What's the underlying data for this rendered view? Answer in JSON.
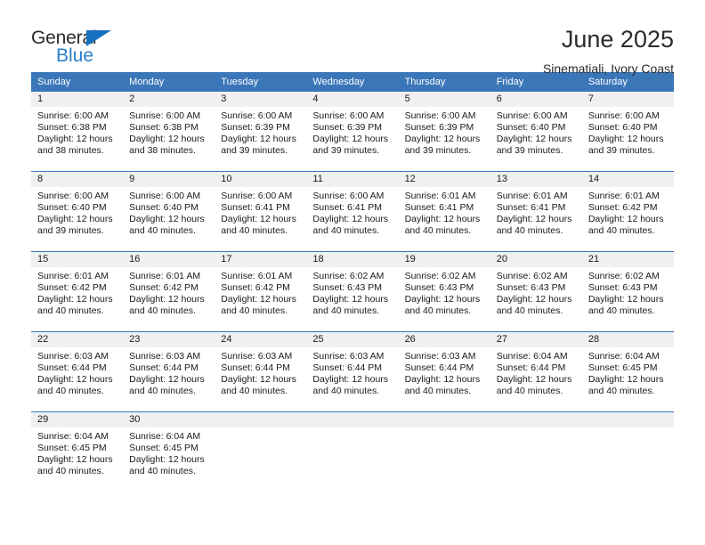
{
  "brand": {
    "name_top": "General",
    "name_bottom": "Blue",
    "triangle_color": "#1670c0",
    "blue_color": "#2a7fc9"
  },
  "header": {
    "title": "June 2025",
    "subtitle": "Sinematiali, Ivory Coast"
  },
  "theme": {
    "header_bg": "#3a76b8",
    "daynum_bg": "#f0f0f0",
    "text": "#1a1a1a"
  },
  "calendar": {
    "weekday_headers": [
      "Sunday",
      "Monday",
      "Tuesday",
      "Wednesday",
      "Thursday",
      "Friday",
      "Saturday"
    ],
    "labels": {
      "sunrise": "Sunrise:",
      "sunset": "Sunset:",
      "daylight": "Daylight:"
    },
    "weeks": [
      [
        {
          "day": "1",
          "sunrise": "Sunrise: 6:00 AM",
          "sunset": "Sunset: 6:38 PM",
          "daylight1": "Daylight: 12 hours",
          "daylight2": "and 38 minutes."
        },
        {
          "day": "2",
          "sunrise": "Sunrise: 6:00 AM",
          "sunset": "Sunset: 6:38 PM",
          "daylight1": "Daylight: 12 hours",
          "daylight2": "and 38 minutes."
        },
        {
          "day": "3",
          "sunrise": "Sunrise: 6:00 AM",
          "sunset": "Sunset: 6:39 PM",
          "daylight1": "Daylight: 12 hours",
          "daylight2": "and 39 minutes."
        },
        {
          "day": "4",
          "sunrise": "Sunrise: 6:00 AM",
          "sunset": "Sunset: 6:39 PM",
          "daylight1": "Daylight: 12 hours",
          "daylight2": "and 39 minutes."
        },
        {
          "day": "5",
          "sunrise": "Sunrise: 6:00 AM",
          "sunset": "Sunset: 6:39 PM",
          "daylight1": "Daylight: 12 hours",
          "daylight2": "and 39 minutes."
        },
        {
          "day": "6",
          "sunrise": "Sunrise: 6:00 AM",
          "sunset": "Sunset: 6:40 PM",
          "daylight1": "Daylight: 12 hours",
          "daylight2": "and 39 minutes."
        },
        {
          "day": "7",
          "sunrise": "Sunrise: 6:00 AM",
          "sunset": "Sunset: 6:40 PM",
          "daylight1": "Daylight: 12 hours",
          "daylight2": "and 39 minutes."
        }
      ],
      [
        {
          "day": "8",
          "sunrise": "Sunrise: 6:00 AM",
          "sunset": "Sunset: 6:40 PM",
          "daylight1": "Daylight: 12 hours",
          "daylight2": "and 39 minutes."
        },
        {
          "day": "9",
          "sunrise": "Sunrise: 6:00 AM",
          "sunset": "Sunset: 6:40 PM",
          "daylight1": "Daylight: 12 hours",
          "daylight2": "and 40 minutes."
        },
        {
          "day": "10",
          "sunrise": "Sunrise: 6:00 AM",
          "sunset": "Sunset: 6:41 PM",
          "daylight1": "Daylight: 12 hours",
          "daylight2": "and 40 minutes."
        },
        {
          "day": "11",
          "sunrise": "Sunrise: 6:00 AM",
          "sunset": "Sunset: 6:41 PM",
          "daylight1": "Daylight: 12 hours",
          "daylight2": "and 40 minutes."
        },
        {
          "day": "12",
          "sunrise": "Sunrise: 6:01 AM",
          "sunset": "Sunset: 6:41 PM",
          "daylight1": "Daylight: 12 hours",
          "daylight2": "and 40 minutes."
        },
        {
          "day": "13",
          "sunrise": "Sunrise: 6:01 AM",
          "sunset": "Sunset: 6:41 PM",
          "daylight1": "Daylight: 12 hours",
          "daylight2": "and 40 minutes."
        },
        {
          "day": "14",
          "sunrise": "Sunrise: 6:01 AM",
          "sunset": "Sunset: 6:42 PM",
          "daylight1": "Daylight: 12 hours",
          "daylight2": "and 40 minutes."
        }
      ],
      [
        {
          "day": "15",
          "sunrise": "Sunrise: 6:01 AM",
          "sunset": "Sunset: 6:42 PM",
          "daylight1": "Daylight: 12 hours",
          "daylight2": "and 40 minutes."
        },
        {
          "day": "16",
          "sunrise": "Sunrise: 6:01 AM",
          "sunset": "Sunset: 6:42 PM",
          "daylight1": "Daylight: 12 hours",
          "daylight2": "and 40 minutes."
        },
        {
          "day": "17",
          "sunrise": "Sunrise: 6:01 AM",
          "sunset": "Sunset: 6:42 PM",
          "daylight1": "Daylight: 12 hours",
          "daylight2": "and 40 minutes."
        },
        {
          "day": "18",
          "sunrise": "Sunrise: 6:02 AM",
          "sunset": "Sunset: 6:43 PM",
          "daylight1": "Daylight: 12 hours",
          "daylight2": "and 40 minutes."
        },
        {
          "day": "19",
          "sunrise": "Sunrise: 6:02 AM",
          "sunset": "Sunset: 6:43 PM",
          "daylight1": "Daylight: 12 hours",
          "daylight2": "and 40 minutes."
        },
        {
          "day": "20",
          "sunrise": "Sunrise: 6:02 AM",
          "sunset": "Sunset: 6:43 PM",
          "daylight1": "Daylight: 12 hours",
          "daylight2": "and 40 minutes."
        },
        {
          "day": "21",
          "sunrise": "Sunrise: 6:02 AM",
          "sunset": "Sunset: 6:43 PM",
          "daylight1": "Daylight: 12 hours",
          "daylight2": "and 40 minutes."
        }
      ],
      [
        {
          "day": "22",
          "sunrise": "Sunrise: 6:03 AM",
          "sunset": "Sunset: 6:44 PM",
          "daylight1": "Daylight: 12 hours",
          "daylight2": "and 40 minutes."
        },
        {
          "day": "23",
          "sunrise": "Sunrise: 6:03 AM",
          "sunset": "Sunset: 6:44 PM",
          "daylight1": "Daylight: 12 hours",
          "daylight2": "and 40 minutes."
        },
        {
          "day": "24",
          "sunrise": "Sunrise: 6:03 AM",
          "sunset": "Sunset: 6:44 PM",
          "daylight1": "Daylight: 12 hours",
          "daylight2": "and 40 minutes."
        },
        {
          "day": "25",
          "sunrise": "Sunrise: 6:03 AM",
          "sunset": "Sunset: 6:44 PM",
          "daylight1": "Daylight: 12 hours",
          "daylight2": "and 40 minutes."
        },
        {
          "day": "26",
          "sunrise": "Sunrise: 6:03 AM",
          "sunset": "Sunset: 6:44 PM",
          "daylight1": "Daylight: 12 hours",
          "daylight2": "and 40 minutes."
        },
        {
          "day": "27",
          "sunrise": "Sunrise: 6:04 AM",
          "sunset": "Sunset: 6:44 PM",
          "daylight1": "Daylight: 12 hours",
          "daylight2": "and 40 minutes."
        },
        {
          "day": "28",
          "sunrise": "Sunrise: 6:04 AM",
          "sunset": "Sunset: 6:45 PM",
          "daylight1": "Daylight: 12 hours",
          "daylight2": "and 40 minutes."
        }
      ],
      [
        {
          "day": "29",
          "sunrise": "Sunrise: 6:04 AM",
          "sunset": "Sunset: 6:45 PM",
          "daylight1": "Daylight: 12 hours",
          "daylight2": "and 40 minutes."
        },
        {
          "day": "30",
          "sunrise": "Sunrise: 6:04 AM",
          "sunset": "Sunset: 6:45 PM",
          "daylight1": "Daylight: 12 hours",
          "daylight2": "and 40 minutes."
        },
        {
          "day": "",
          "sunrise": "",
          "sunset": "",
          "daylight1": "",
          "daylight2": ""
        },
        {
          "day": "",
          "sunrise": "",
          "sunset": "",
          "daylight1": "",
          "daylight2": ""
        },
        {
          "day": "",
          "sunrise": "",
          "sunset": "",
          "daylight1": "",
          "daylight2": ""
        },
        {
          "day": "",
          "sunrise": "",
          "sunset": "",
          "daylight1": "",
          "daylight2": ""
        },
        {
          "day": "",
          "sunrise": "",
          "sunset": "",
          "daylight1": "",
          "daylight2": ""
        }
      ]
    ]
  }
}
